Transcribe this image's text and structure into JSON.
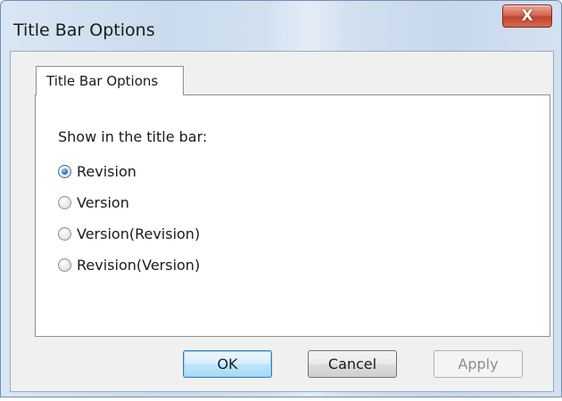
{
  "window": {
    "title": "Title Bar Options",
    "close_glyph": "X"
  },
  "tabs": [
    {
      "label": "Title Bar Options",
      "selected": true
    }
  ],
  "group": {
    "label": "Show in the title bar:",
    "options": [
      {
        "label": "Revision",
        "checked": true
      },
      {
        "label": "Version",
        "checked": false
      },
      {
        "label": "Version(Revision)",
        "checked": false
      },
      {
        "label": "Revision(Version)",
        "checked": false
      }
    ]
  },
  "buttons": {
    "ok_label": "OK",
    "cancel_label": "Cancel",
    "apply_label": "Apply",
    "apply_enabled": false
  },
  "colors": {
    "accent": "#2d78c7",
    "close_button": "#c0432b"
  },
  "icons": {
    "close": "close-icon",
    "radio_checked": "radio-checked-icon",
    "radio_unchecked": "radio-unchecked-icon"
  }
}
